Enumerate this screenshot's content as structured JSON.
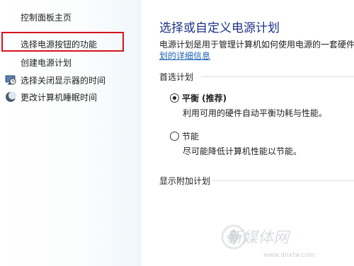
{
  "sidebar": {
    "home_link": "控制面板主页",
    "items": [
      {
        "label": "选择电源按钮的功能",
        "icon": null
      },
      {
        "label": "创建电源计划",
        "icon": null
      },
      {
        "label": "选择关闭显示器的时间",
        "icon": "display-clock-icon"
      },
      {
        "label": "更改计算机睡眠时间",
        "icon": "moon-sleep-icon"
      }
    ],
    "highlight_color": "#d4141c"
  },
  "main": {
    "title": "选择或自定义电源计划",
    "description": "电源计划是用于管理计算机如何使用电源的一套硬件",
    "description_link": "划的详细信息",
    "preferred_plans": {
      "heading": "首选计划",
      "plans": [
        {
          "name": "平衡 (推荐)",
          "description": "利用可用的硬件自动平衡功耗与性能。",
          "selected": true
        },
        {
          "name": "节能",
          "description": "尽可能降低计算机性能以节能。",
          "selected": false
        }
      ]
    },
    "additional_plans": {
      "heading": "显示附加计划"
    }
  },
  "watermark": {
    "text": "新媒体网",
    "url": "www.dnxtw.com"
  },
  "colors": {
    "title": "#1e3287",
    "link": "#1a5fb4"
  }
}
